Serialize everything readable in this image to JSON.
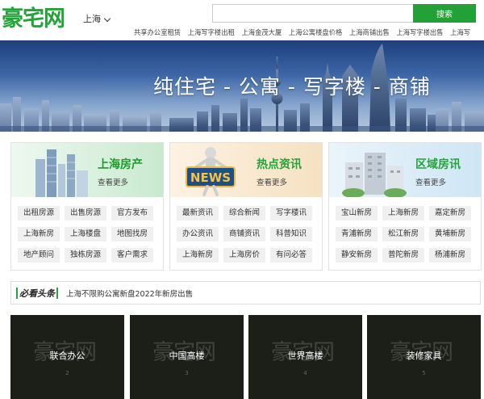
{
  "header": {
    "logo": "豪宅网",
    "city": "上海",
    "search_placeholder": "",
    "search_button": "搜索",
    "hot_links": [
      "共享办公室租赁",
      "上海写字楼出租",
      "上海金茂大厦",
      "上海公寓楼盘价格",
      "上海商铺出售",
      "上海写字楼出售",
      "上海写"
    ]
  },
  "banner": {
    "slogan": "纯住宅 - 公寓 - 写字楼 - 商铺"
  },
  "cards": [
    {
      "title": "上海房产",
      "more": "查看更多",
      "title_color": "#1e9a2e",
      "links": [
        "出租房源",
        "出售房源",
        "官方发布",
        "上海新房",
        "上海楼盘",
        "地图找房",
        "地产顾问",
        "独栋房源",
        "客户需求"
      ]
    },
    {
      "title": "热点资讯",
      "more": "查看更多",
      "title_color": "#23a33a",
      "links": [
        "最新资讯",
        "综合新闻",
        "写字楼讯",
        "办公资讯",
        "商铺资讯",
        "科普知识",
        "上海新房",
        "上海房价",
        "有问必答"
      ]
    },
    {
      "title": "区域房讯",
      "more": "查看更多",
      "title_color": "#23a33a",
      "links": [
        "宝山新房",
        "上海新房",
        "嘉定新房",
        "青浦新房",
        "松江新房",
        "黄埔新房",
        "静安新房",
        "普陀新房",
        "杨浦新房"
      ]
    }
  ],
  "headline": {
    "badge": "必看头条",
    "text": "上海不限购公寓新盘2022年新房出售"
  },
  "tiles": [
    {
      "watermark": "豪宅网",
      "label": "联合办公",
      "num": "2"
    },
    {
      "watermark": "豪宅网",
      "label": "中国高楼",
      "num": "3"
    },
    {
      "watermark": "豪宅网",
      "label": "世界高楼",
      "num": "4"
    },
    {
      "watermark": "豪宅网",
      "label": "装修家具",
      "num": "5"
    }
  ],
  "colors": {
    "brand": "#23a33a",
    "button": "#22a236"
  }
}
